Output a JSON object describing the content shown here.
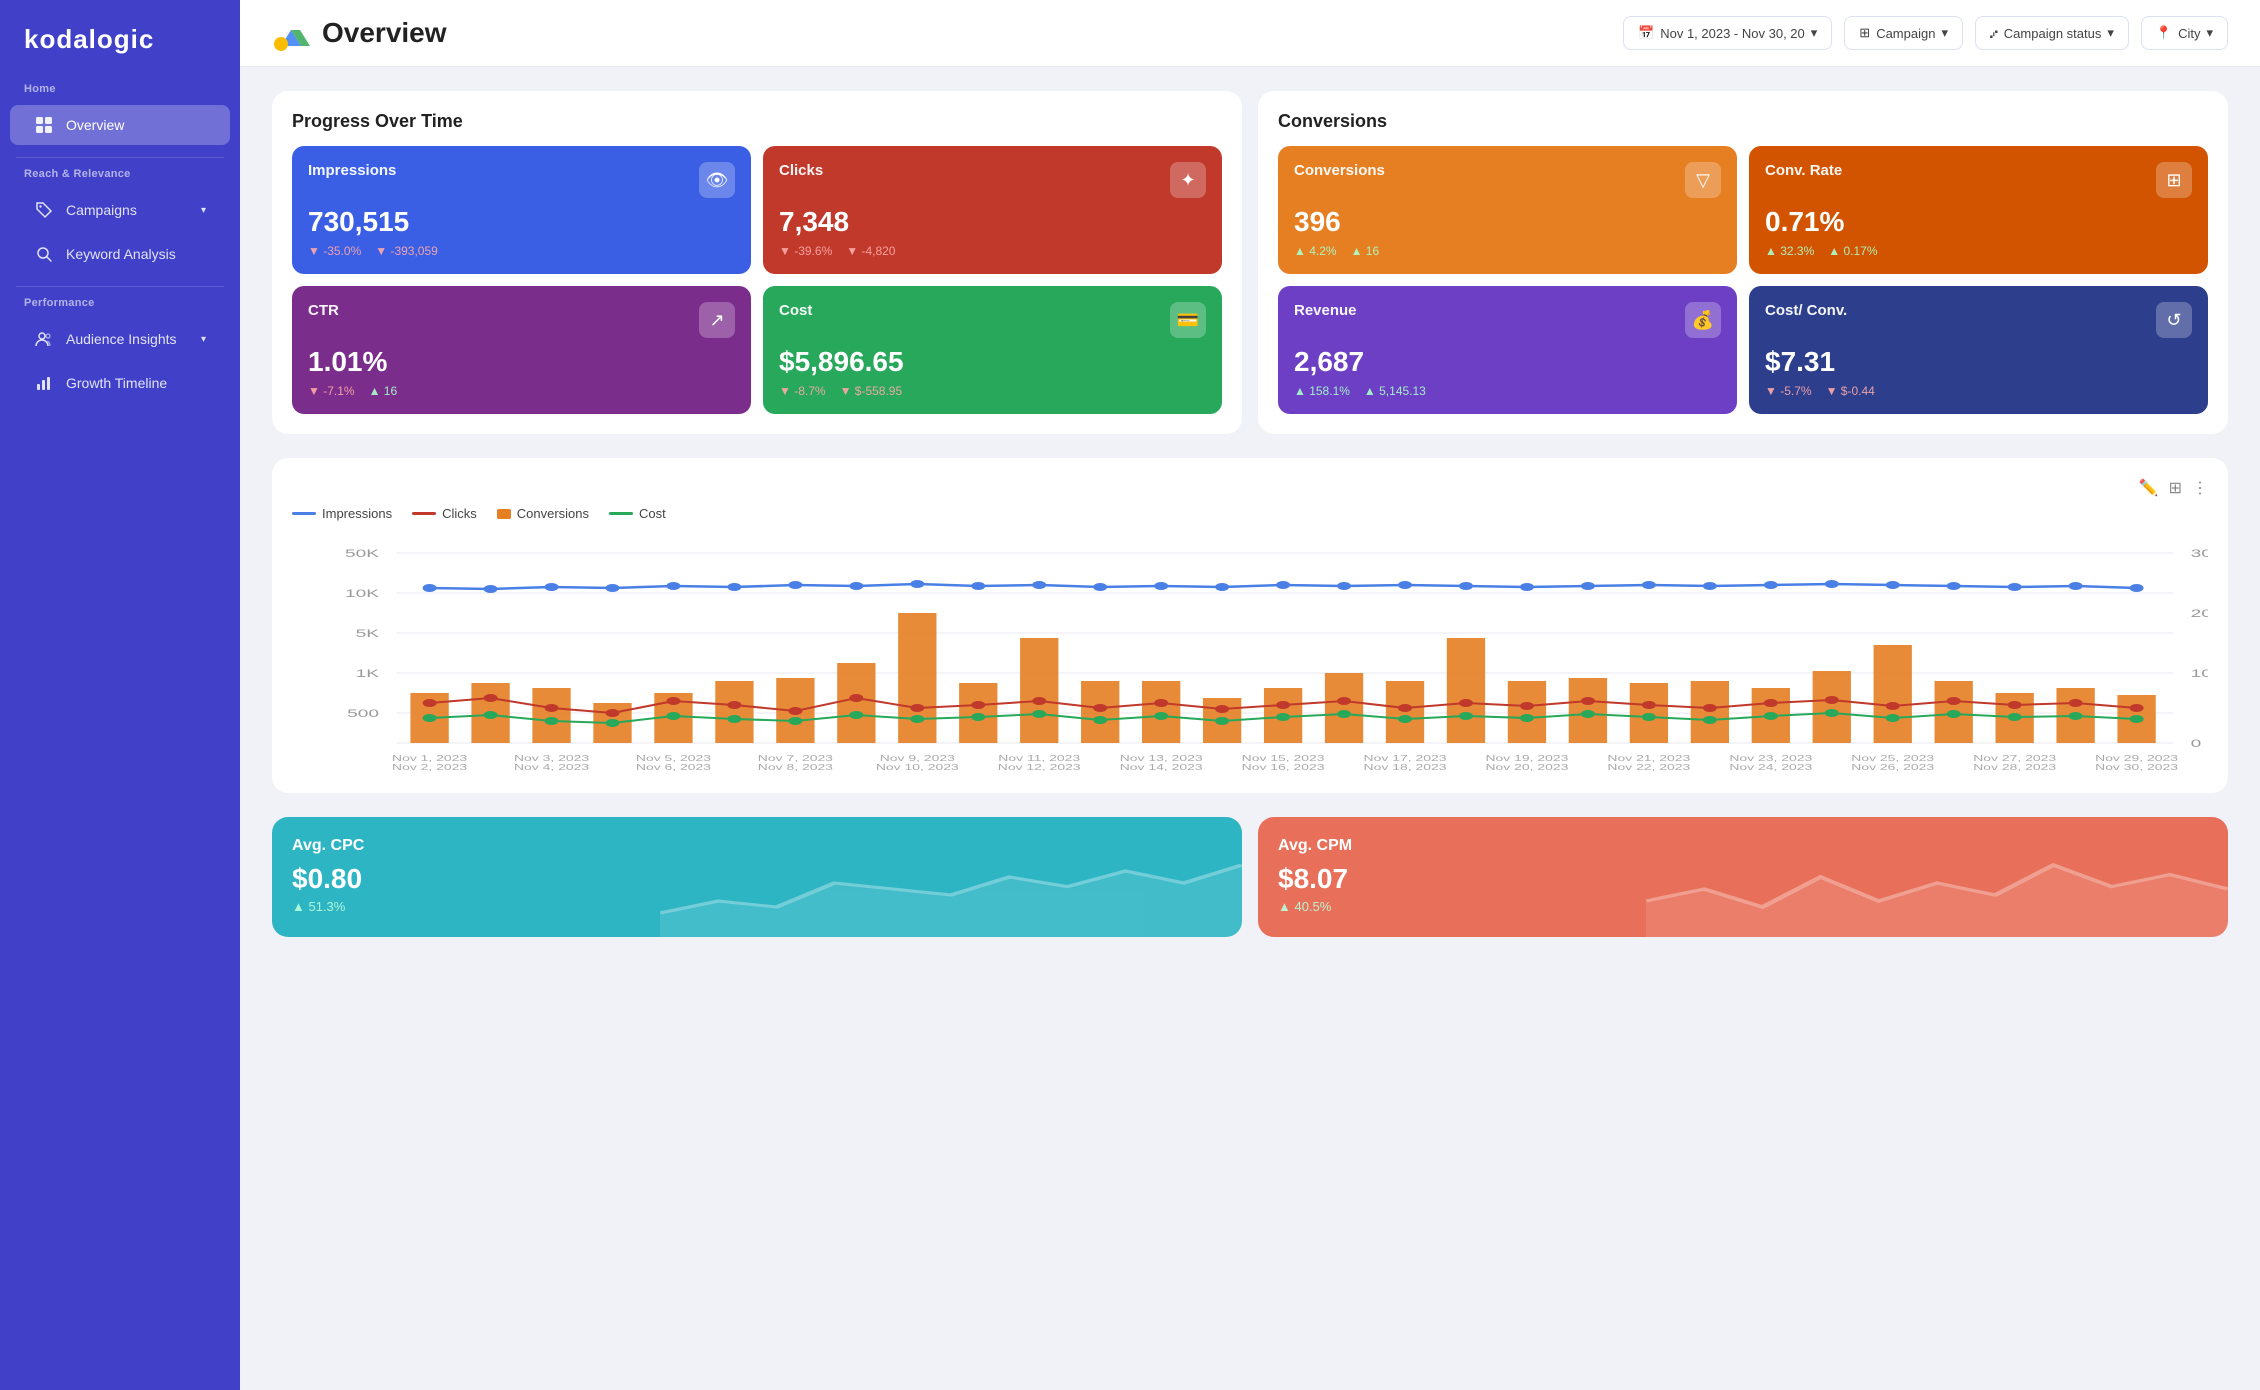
{
  "sidebar": {
    "logo": "kodalogic",
    "sections": [
      {
        "label": "Home",
        "items": [
          {
            "id": "overview",
            "label": "Overview",
            "active": true,
            "icon": "grid"
          }
        ]
      },
      {
        "label": "Reach & Relevance",
        "items": [
          {
            "id": "campaigns",
            "label": "Campaigns",
            "active": false,
            "icon": "tag",
            "hasChevron": true
          },
          {
            "id": "keyword-analysis",
            "label": "Keyword Analysis",
            "active": false,
            "icon": "search"
          }
        ]
      },
      {
        "label": "Performance",
        "items": [
          {
            "id": "audience-insights",
            "label": "Audience Insights",
            "active": false,
            "icon": "users",
            "hasChevron": true
          },
          {
            "id": "growth-timeline",
            "label": "Growth Timeline",
            "active": false,
            "icon": "chart"
          }
        ]
      }
    ]
  },
  "header": {
    "title": "Overview",
    "filters": {
      "date": "Nov 1, 2023 - Nov 30, 20",
      "campaign": "Campaign",
      "status": "Campaign status",
      "city": "City"
    }
  },
  "progress": {
    "title": "Progress Over Time",
    "cards": [
      {
        "id": "impressions",
        "label": "Impressions",
        "value": "730,515",
        "color": "blue",
        "stat1": "▼ -35.0%",
        "stat2": "▼ -393,059",
        "icon": "👁"
      },
      {
        "id": "clicks",
        "label": "Clicks",
        "value": "7,348",
        "color": "red",
        "stat1": "▼ -39.6%",
        "stat2": "▼ -4,820",
        "icon": "✦"
      },
      {
        "id": "ctr",
        "label": "CTR",
        "value": "1.01%",
        "color": "purple",
        "stat1": "▼ -7.1%",
        "stat2": "▲ 16",
        "icon": "↗"
      },
      {
        "id": "cost",
        "label": "Cost",
        "value": "$5,896.65",
        "color": "green",
        "stat1": "▼ -8.7%",
        "stat2": "▼ $-558.95",
        "icon": "💳"
      }
    ]
  },
  "conversions": {
    "title": "Conversions",
    "cards": [
      {
        "id": "conversions",
        "label": "Conversions",
        "value": "396",
        "color": "orange",
        "stat1": "▲ 4.2%",
        "stat2": "▲ 16",
        "icon": "▽"
      },
      {
        "id": "conv-rate",
        "label": "Conv. Rate",
        "value": "0.71%",
        "color": "orange2",
        "stat1": "▲ 32.3%",
        "stat2": "▲ 0.17%",
        "icon": "⊞"
      },
      {
        "id": "revenue",
        "label": "Revenue",
        "value": "2,687",
        "color": "violet",
        "stat1": "▲ 158.1%",
        "stat2": "▲ 5,145.13",
        "icon": "💰"
      },
      {
        "id": "cost-conv",
        "label": "Cost/ Conv.",
        "value": "$7.31",
        "color": "darkblue",
        "stat1": "▼ -5.7%",
        "stat2": "▼ $-0.44",
        "icon": "↺"
      }
    ]
  },
  "chart": {
    "legend": [
      {
        "label": "Impressions",
        "color": "#4a7fe5",
        "type": "line"
      },
      {
        "label": "Clicks",
        "color": "#c0392b",
        "type": "line"
      },
      {
        "label": "Conversions",
        "color": "#e67e22",
        "type": "bar"
      },
      {
        "label": "Cost",
        "color": "#27a85a",
        "type": "line"
      }
    ],
    "yLabels": [
      "50K",
      "10K",
      "5K",
      "1K",
      "500",
      ""
    ],
    "xLabels": [
      "Nov 1, 2023",
      "Nov 2, 2023",
      "Nov 3, 2023",
      "Nov 4, 2023",
      "Nov 5, 2023",
      "Nov 6, 2023",
      "Nov 7, 2023",
      "Nov 8, 2023",
      "Nov 9, 2023",
      "Nov 10, 2023",
      "Nov 11, 2023",
      "Nov 12, 2023",
      "Nov 13, 2023",
      "Nov 14, 2023",
      "Nov 15, 2023",
      "Nov 16, 2023",
      "Nov 17, 2023",
      "Nov 18, 2023",
      "Nov 19, 2023",
      "Nov 20, 2023",
      "Nov 21, 2023",
      "Nov 22, 2023",
      "Nov 23, 2023",
      "Nov 24, 2023",
      "Nov 25, 2023",
      "Nov 26, 2023",
      "Nov 27, 2023",
      "Nov 28, 2023",
      "Nov 29, 2023",
      "Nov 30, 2023"
    ]
  },
  "bottomCards": [
    {
      "id": "avg-cpc",
      "label": "Avg. CPC",
      "value": "$0.80",
      "stat": "▲ 51.3%",
      "statType": "up",
      "color": "teal"
    },
    {
      "id": "avg-cpm",
      "label": "Avg. CPM",
      "value": "$8.07",
      "stat": "▲ 40.5%",
      "statType": "up",
      "color": "salmon"
    }
  ]
}
